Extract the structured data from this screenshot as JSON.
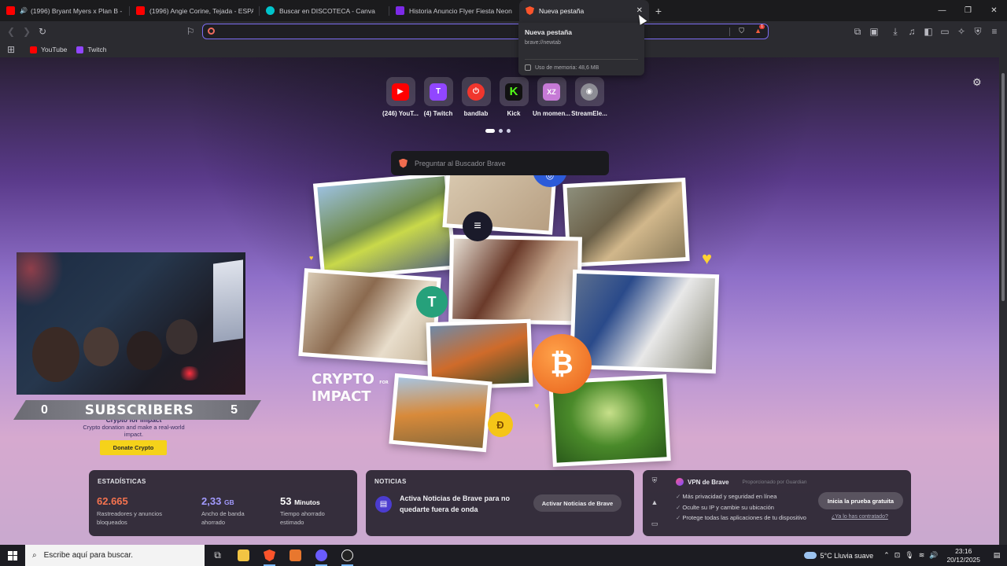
{
  "tabs": [
    {
      "title": "(1996) Bryant Myers x Plan B - Po",
      "favicon_color": "#ff0000",
      "audio": true
    },
    {
      "title": "(1996) Angie Corine, Tejada - ESPAÑO",
      "favicon_color": "#ff0000",
      "audio": false
    },
    {
      "title": "Buscar en DISCOTECA - Canva",
      "favicon_color": "#00c4cc",
      "audio": false
    },
    {
      "title": "Historia Anuncio Flyer Fiesta Neon Pu",
      "favicon_color": "#7d2ae8",
      "audio": false
    },
    {
      "title": "Nueva pestaña",
      "favicon_color": "#fb542b",
      "audio": false,
      "active": true
    }
  ],
  "tab_tooltip": {
    "title": "Nueva pestaña",
    "url": "brave://newtab",
    "memory": "Uso de memoria: 48,6 MB"
  },
  "address_bar": {
    "value": "",
    "rewards_badge": "1"
  },
  "bookmarks": [
    {
      "label": "YouTube",
      "color": "#ff0000"
    },
    {
      "label": "Twitch",
      "color": "#9146ff"
    }
  ],
  "top_sites": [
    {
      "label": "(246) YouT...",
      "color": "#ff0000",
      "glyph": "▶"
    },
    {
      "label": "(4) Twitch",
      "color": "#9146ff",
      "glyph": "T"
    },
    {
      "label": "bandlab",
      "color": "#f0362d",
      "glyph": "⏻"
    },
    {
      "label": "Kick",
      "color": "#53fc18",
      "glyph": "K"
    },
    {
      "label": "Un momen...",
      "color": "#c67ad6",
      "glyph": "XZ"
    },
    {
      "label": "StreamEle...",
      "color": "#8d8d95",
      "glyph": "◉"
    }
  ],
  "search": {
    "placeholder": "Preguntar al Buscador Brave"
  },
  "stream_overlay": {
    "left_count": "0",
    "label": "SUBSCRIBERS",
    "right_count": "5"
  },
  "crypto_card": {
    "behind_title": "Crypto for impact",
    "text": "Crypto donation and make a real-world impact.",
    "button": "Donate Crypto",
    "banner_line1": "CRYPTO",
    "banner_for": "FOR",
    "banner_line2": "IMPACT"
  },
  "stats": {
    "title": "ESTADÍSTICAS",
    "items": [
      {
        "value": "62.665",
        "unit": "",
        "desc": "Rastreadores y anuncios bloqueados",
        "color": "#f5734f"
      },
      {
        "value": "2,33",
        "unit": "GB",
        "desc": "Ancho de banda ahorrado",
        "color": "#a39bff"
      },
      {
        "value": "53",
        "unit": "Minutos",
        "desc": "Tiempo ahorrado estimado",
        "color": "#ffffff"
      }
    ]
  },
  "news": {
    "title": "NOTICIAS",
    "text": "Activa Noticias de Brave para no quedarte fuera de onda",
    "button": "Activar Noticias de Brave"
  },
  "vpn": {
    "title": "VPN de Brave",
    "powered": "Proporcionado por  Guardian",
    "features": [
      "Más privacidad y seguridad en línea",
      "Oculte su IP y cambie su ubicación",
      "Protege todas las aplicaciones de tu dispositivo"
    ],
    "button": "Inicia la prueba gratuita",
    "link": "¿Ya lo has contratado?"
  },
  "taskbar": {
    "search_placeholder": "Escribe aquí para buscar.",
    "weather": "5°C  Lluvia suave",
    "time": "23:16",
    "date": "20/12/2025"
  }
}
